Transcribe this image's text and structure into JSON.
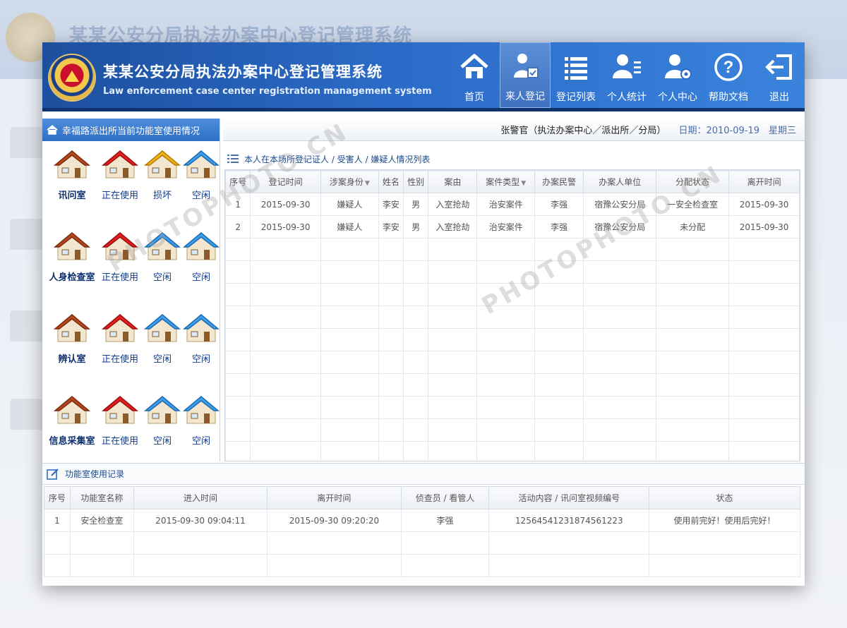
{
  "background": {
    "title": "某某公安分局执法办案中心登记管理系统"
  },
  "header": {
    "title_zh": "某某公安分局执法办案中心登记管理系统",
    "title_en": "Law enforcement case center registration management system",
    "nav": [
      {
        "label": "首页",
        "icon": "home-icon"
      },
      {
        "label": "来人登记",
        "icon": "person-register-icon",
        "active": true
      },
      {
        "label": "登记列表",
        "icon": "list-icon"
      },
      {
        "label": "个人统计",
        "icon": "person-stats-icon"
      },
      {
        "label": "个人中心",
        "icon": "person-settings-icon"
      },
      {
        "label": "帮助文档",
        "icon": "help-icon"
      },
      {
        "label": "退出",
        "icon": "logout-icon"
      }
    ]
  },
  "left_panel": {
    "title": "幸福路派出所当前功能室使用情况",
    "rows": [
      {
        "name": "讯问室",
        "rooms": [
          {
            "status": "正在使用",
            "color": "red"
          },
          {
            "status": "损坏",
            "color": "yellow"
          },
          {
            "status": "空闲",
            "color": "blue"
          }
        ]
      },
      {
        "name": "人身检查室",
        "rooms": [
          {
            "status": "正在使用",
            "color": "red"
          },
          {
            "status": "空闲",
            "color": "blue"
          },
          {
            "status": "空闲",
            "color": "blue"
          }
        ]
      },
      {
        "name": "辨认室",
        "rooms": [
          {
            "status": "正在使用",
            "color": "red"
          },
          {
            "status": "空闲",
            "color": "blue"
          },
          {
            "status": "空闲",
            "color": "blue"
          }
        ]
      },
      {
        "name": "信息采集室",
        "rooms": [
          {
            "status": "正在使用",
            "color": "red"
          },
          {
            "status": "空闲",
            "color": "blue"
          },
          {
            "status": "空闲",
            "color": "blue"
          }
        ]
      }
    ]
  },
  "userbar": {
    "user": "张警官（执法办案中心／派出所／分局）",
    "date": "日期：2010-09-19　星期三"
  },
  "list": {
    "title": "本人在本场所登记证人 / 受害人 / 嫌疑人情况列表",
    "columns": [
      "序号",
      "登记时间",
      "涉案身份",
      "姓名",
      "性别",
      "案由",
      "案件类型",
      "办案民警",
      "办案人单位",
      "分配状态",
      "离开时间"
    ],
    "rows": [
      [
        "1",
        "2015-09-30",
        "嫌疑人",
        "李安",
        "男",
        "入室抢劫",
        "治安案件",
        "李强",
        "宿豫公安分局",
        "一安全检查室",
        "2015-09-30"
      ],
      [
        "2",
        "2015-09-30",
        "嫌疑人",
        "李安",
        "男",
        "入室抢劫",
        "治安案件",
        "李强",
        "宿豫公安分局",
        "未分配",
        "2015-09-30"
      ]
    ]
  },
  "records": {
    "title": "功能室使用记录",
    "columns": [
      "序号",
      "功能室名称",
      "进入时间",
      "离开时间",
      "侦查员 / 看管人",
      "活动内容 / 讯问室视频编号",
      "状态"
    ],
    "rows": [
      [
        "1",
        "安全检查室",
        "2015-09-30 09:04:11",
        "2015-09-30 09:20:20",
        "李强",
        "12564541231874561223",
        "使用前完好！使用后完好！"
      ]
    ]
  },
  "colors": {
    "header_start": "#1d4f9e",
    "header_end": "#3a83dd",
    "accent": "#2e6ec4"
  }
}
